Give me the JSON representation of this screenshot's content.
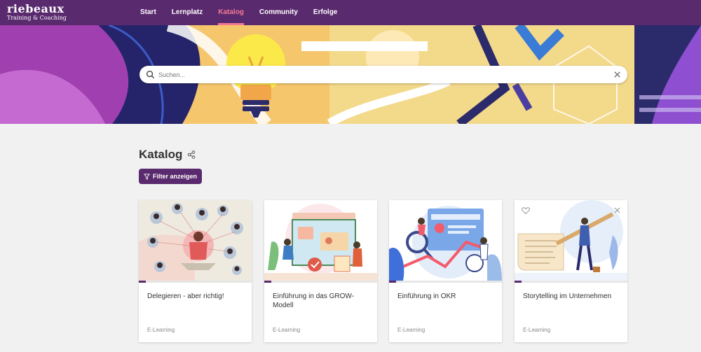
{
  "brand": {
    "name": "riebeaux",
    "tagline": "Training & Coaching"
  },
  "nav": [
    {
      "label": "Start",
      "active": false
    },
    {
      "label": "Lernplatz",
      "active": false
    },
    {
      "label": "Katalog",
      "active": true
    },
    {
      "label": "Community",
      "active": false
    },
    {
      "label": "Erfolge",
      "active": false
    }
  ],
  "search": {
    "placeholder": "Suchen...",
    "value": ""
  },
  "catalog": {
    "title": "Katalog",
    "filter_label": "Filter anzeigen"
  },
  "cards": [
    {
      "title": "Delegieren - aber richtig!",
      "type": "E-Learning",
      "progress": 0.06
    },
    {
      "title": "Einführung in das GROW-Modell",
      "type": "E-Learning",
      "progress": 0.06
    },
    {
      "title": "Einführung in OKR",
      "type": "E-Learning",
      "progress": 0.06
    },
    {
      "title": "Storytelling im Unternehmen",
      "type": "E-Learning",
      "progress": 0.06
    }
  ],
  "colors": {
    "primary": "#5a2a6e",
    "accent": "#f37a95",
    "background": "#f1f1f1"
  },
  "icons": [
    "search-icon",
    "clear-icon",
    "share-icon",
    "filter-icon",
    "heart-icon",
    "close-icon"
  ]
}
